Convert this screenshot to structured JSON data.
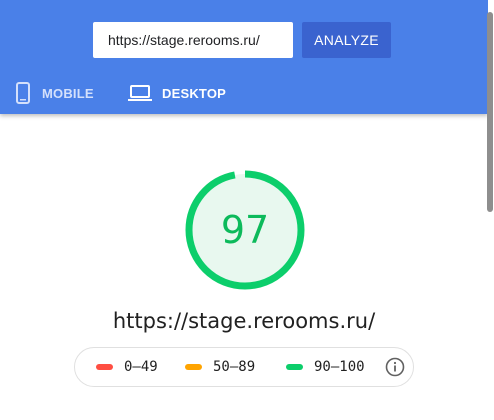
{
  "search": {
    "url_value": "https://stage.rerooms.ru/",
    "analyze_label": "ANALYZE"
  },
  "tabs": [
    {
      "label": "MOBILE",
      "icon": "smartphone-icon",
      "selected": false
    },
    {
      "label": "DESKTOP",
      "icon": "laptop-icon",
      "selected": true
    }
  ],
  "result": {
    "score": "97",
    "score_fraction": 0.97,
    "url": "https://stage.rerooms.ru/"
  },
  "legend": [
    {
      "label": "0–49",
      "color": "#ff4e42"
    },
    {
      "label": "50–89",
      "color": "#ffa400"
    },
    {
      "label": "90–100",
      "color": "#0cce6b"
    }
  ],
  "colors": {
    "header": "#4a80e8",
    "button": "#3a63cf",
    "score_text": "#0cba5b",
    "gauge_fill": "#e8f8ef"
  }
}
